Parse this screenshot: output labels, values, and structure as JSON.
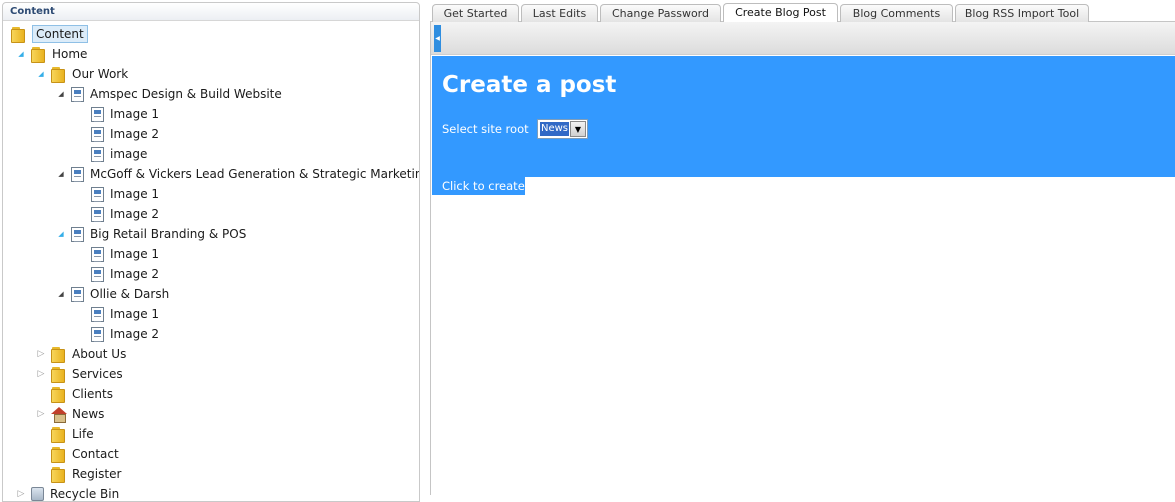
{
  "tree": {
    "header": "Content",
    "items": [
      {
        "label": "Content",
        "icon": "folder-icon",
        "toggle": "",
        "selected": true
      },
      {
        "label": "Home",
        "icon": "folder-icon",
        "toggle": "open-blue"
      },
      {
        "label": "Our Work",
        "icon": "folder-icon",
        "toggle": "open-blue"
      },
      {
        "label": "Amspec Design & Build Website",
        "icon": "page-icon",
        "toggle": "open"
      },
      {
        "label": "Image 1",
        "icon": "page-icon",
        "toggle": ""
      },
      {
        "label": "Image 2",
        "icon": "page-icon",
        "toggle": ""
      },
      {
        "label": "image",
        "icon": "page-icon",
        "toggle": ""
      },
      {
        "label": "McGoff & Vickers Lead Generation & Strategic Marketing",
        "icon": "page-icon",
        "toggle": "open"
      },
      {
        "label": "Image 1",
        "icon": "page-icon",
        "toggle": ""
      },
      {
        "label": "Image 2",
        "icon": "page-icon",
        "toggle": ""
      },
      {
        "label": "Big Retail Branding & POS",
        "icon": "page-icon",
        "toggle": "open-blue"
      },
      {
        "label": "Image 1",
        "icon": "page-icon",
        "toggle": ""
      },
      {
        "label": "Image 2",
        "icon": "page-icon",
        "toggle": ""
      },
      {
        "label": "Ollie & Darsh",
        "icon": "page-icon",
        "toggle": "open"
      },
      {
        "label": "Image 1",
        "icon": "page-icon",
        "toggle": ""
      },
      {
        "label": "Image 2",
        "icon": "page-icon",
        "toggle": ""
      },
      {
        "label": "About Us",
        "icon": "folder-icon",
        "toggle": "collapsed"
      },
      {
        "label": "Services",
        "icon": "folder-icon",
        "toggle": "collapsed"
      },
      {
        "label": "Clients",
        "icon": "folder-icon",
        "toggle": ""
      },
      {
        "label": "News",
        "icon": "home-icon",
        "toggle": "collapsed"
      },
      {
        "label": "Life",
        "icon": "folder-icon",
        "toggle": ""
      },
      {
        "label": "Contact",
        "icon": "folder-icon",
        "toggle": ""
      },
      {
        "label": "Register",
        "icon": "folder-icon",
        "toggle": ""
      },
      {
        "label": "Recycle Bin",
        "icon": "recycle-bin-icon",
        "toggle": "collapsed"
      }
    ]
  },
  "tabs": [
    {
      "label": "Get Started",
      "active": false
    },
    {
      "label": "Last Edits",
      "active": false
    },
    {
      "label": "Change Password",
      "active": false
    },
    {
      "label": "Create Blog Post",
      "active": true
    },
    {
      "label": "Blog Comments",
      "active": false
    },
    {
      "label": "Blog RSS Import Tool",
      "active": false
    }
  ],
  "blog_post": {
    "title": "Create a post",
    "site_root_label": "Select site root",
    "site_root_value": "News",
    "create_link": "Click to create"
  },
  "colors": {
    "accent": "#3399ff",
    "selection": "#3169c6"
  }
}
